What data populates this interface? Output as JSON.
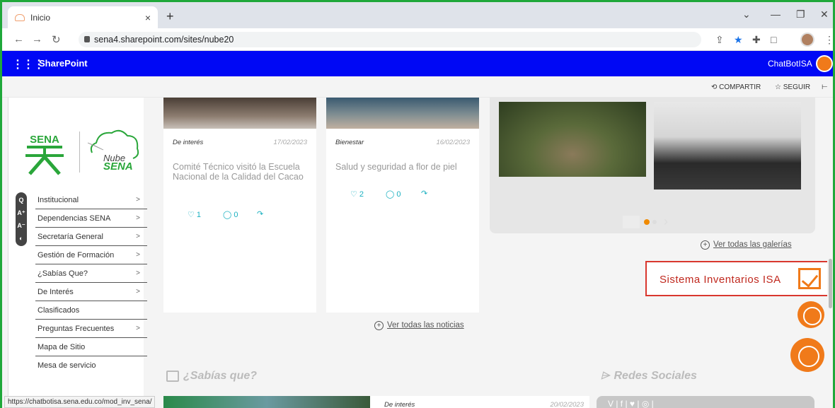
{
  "browser": {
    "tab_title": "Inicio",
    "tab_close": "×",
    "new_tab": "+",
    "url": "sena4.sharepoint.com/sites/nube20",
    "window_controls": [
      "⌄",
      "—",
      "❐",
      "✕"
    ]
  },
  "sharepoint": {
    "app_name": "SharePoint",
    "user_name": "ChatBotISA",
    "accent_color": "#0008f5"
  },
  "commandbar": {
    "share_label": "COMPARTIR",
    "follow_label": "SEGUIR"
  },
  "logo": {
    "nube_line1": "Nube",
    "nube_line2": "SENA"
  },
  "accessibility": [
    "Q",
    "A⁺",
    "A⁻",
    "◐"
  ],
  "nav": {
    "items": [
      {
        "label": "Institucional",
        "chevron": ">"
      },
      {
        "label": "Dependencias SENA",
        "chevron": ">"
      },
      {
        "label": "Secretaría General",
        "chevron": ">"
      },
      {
        "label": "Gestión de Formación",
        "chevron": ">"
      },
      {
        "label": "¿Sabías Que?",
        "chevron": ">"
      },
      {
        "label": "De Interés",
        "chevron": ">"
      },
      {
        "label": "Clasificados",
        "chevron": ""
      },
      {
        "label": "Preguntas Frecuentes",
        "chevron": ">"
      },
      {
        "label": "Mapa de Sitio",
        "chevron": ""
      },
      {
        "label": "Mesa de servicio",
        "chevron": ""
      }
    ]
  },
  "news": {
    "cards": [
      {
        "category": "De interés",
        "date": "17/02/2023",
        "title": "Comité Técnico visitó la Escuela Nacional de la Calidad del Cacao",
        "likes": "1",
        "comments": "0"
      },
      {
        "category": "Bienestar",
        "date": "16/02/2023",
        "title": "Salud y seguridad a flor de piel",
        "likes": "2",
        "comments": "0"
      }
    ],
    "see_all": "Ver todas las noticias"
  },
  "gallery": {
    "see_all": "Ver todas las galerías"
  },
  "inventory_button": {
    "label": "Sistema Inventarios ISA",
    "border_color": "#d9372e"
  },
  "sections": {
    "sabias_que": "¿Sabías que?",
    "redes_sociales": "Redes Sociales"
  },
  "bottom_card": {
    "category": "De interés",
    "date": "20/02/2023"
  },
  "social_icons": "V  |  f  |  ♥  |  ◎  |",
  "status_url": "https://chatbotisa.sena.edu.co/mod_inv_sena/"
}
